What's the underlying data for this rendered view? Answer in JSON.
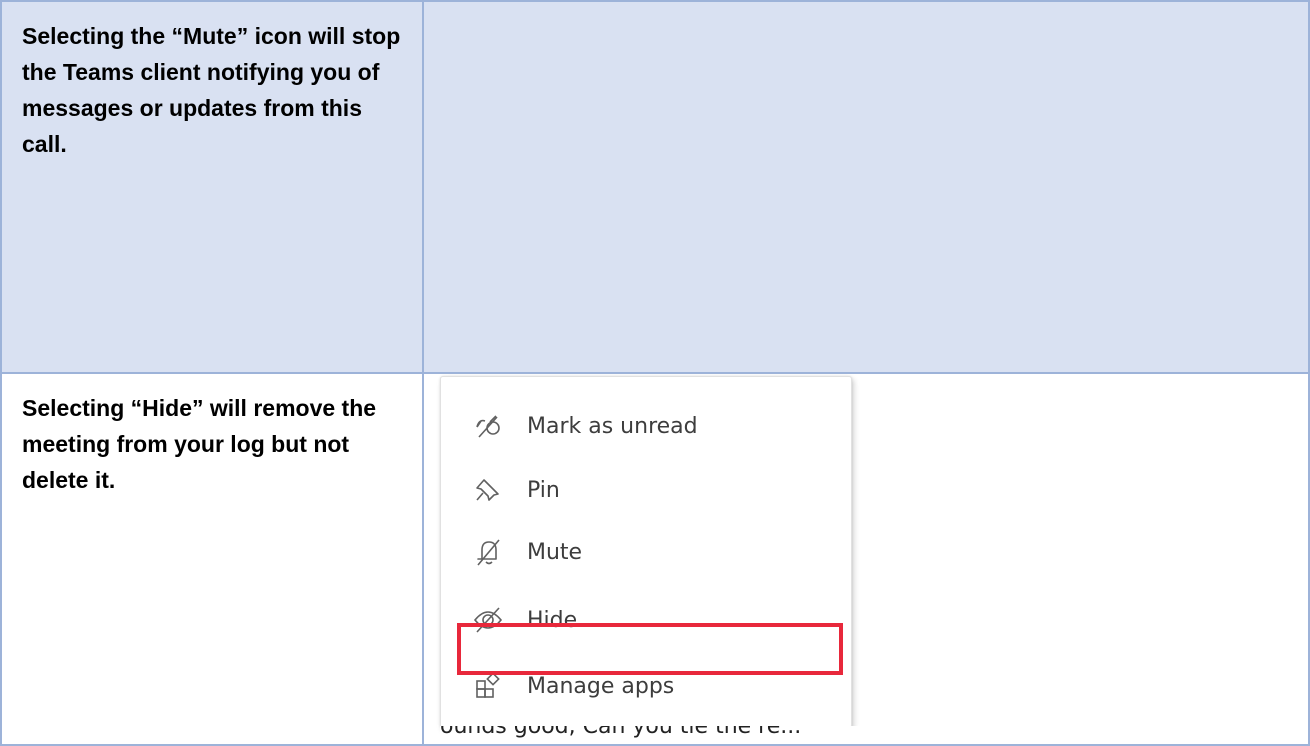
{
  "rows": [
    {
      "instruction": "Selecting the “Mute” icon will stop the Teams client notifying you of messages or updates from this call."
    },
    {
      "instruction": "Selecting “Hide” will remove the meeting from your log but not delete it."
    }
  ],
  "context_menu": {
    "items": [
      {
        "label": "Mark as unread",
        "icon": "mark-unread-icon"
      },
      {
        "label": "Pin",
        "icon": "pin-icon"
      },
      {
        "label": "Mute",
        "icon": "bell-off-icon"
      },
      {
        "label": "Hide",
        "icon": "eye-off-icon"
      },
      {
        "label": "Manage apps",
        "icon": "apps-icon"
      }
    ],
    "highlighted_item": "Hide",
    "highlight_color": "#e8283b"
  },
  "background_chat_preview": "ounds good, Can you tie the re..."
}
